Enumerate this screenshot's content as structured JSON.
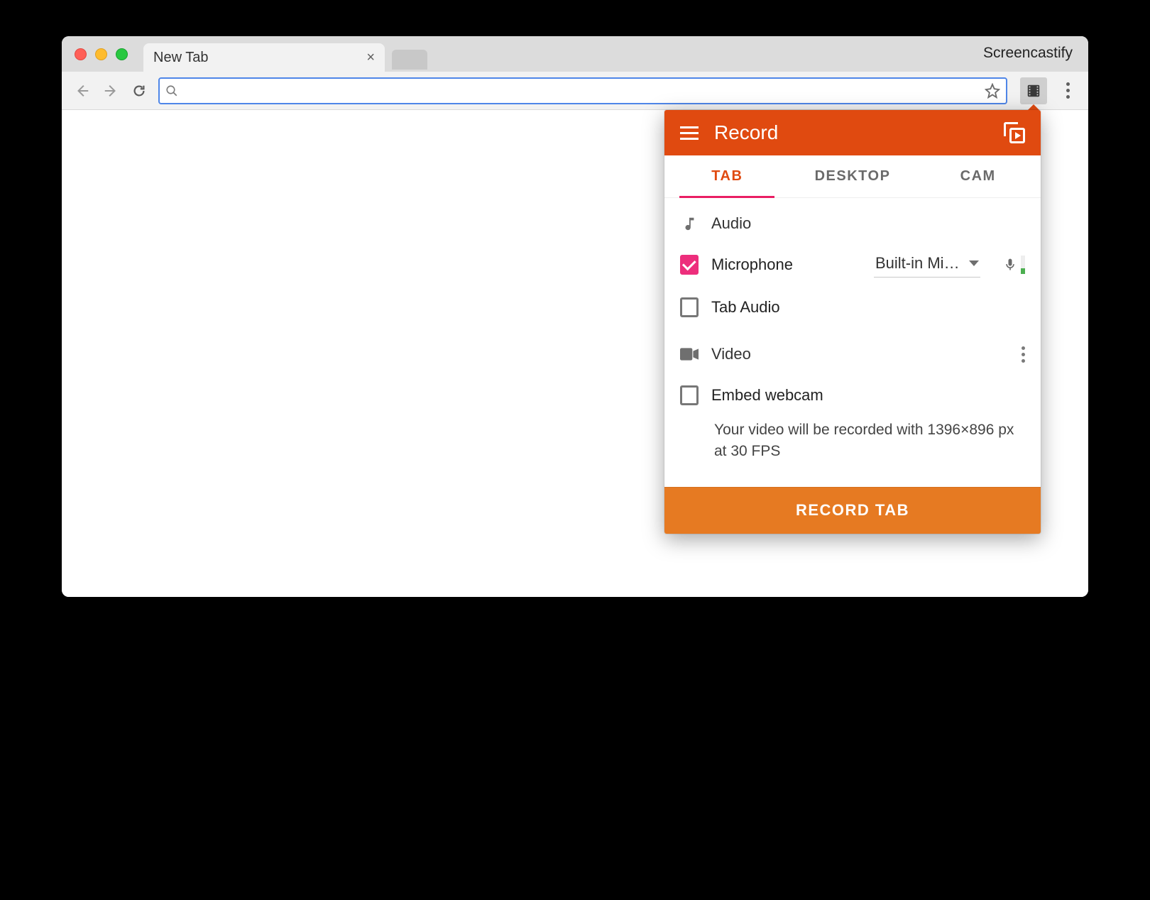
{
  "browser": {
    "tab_title": "New Tab",
    "watermark": "Screencastify"
  },
  "popup": {
    "title": "Record",
    "tabs": {
      "tab": "TAB",
      "desktop": "DESKTOP",
      "cam": "CAM"
    },
    "audio_section": "Audio",
    "microphone_label": "Microphone",
    "microphone_device": "Built-in Mi…",
    "tab_audio_label": "Tab Audio",
    "video_section": "Video",
    "embed_webcam_label": "Embed webcam",
    "hint": "Your video will be recorded with 1396×896 px at 30 FPS",
    "record_button": "RECORD TAB"
  }
}
